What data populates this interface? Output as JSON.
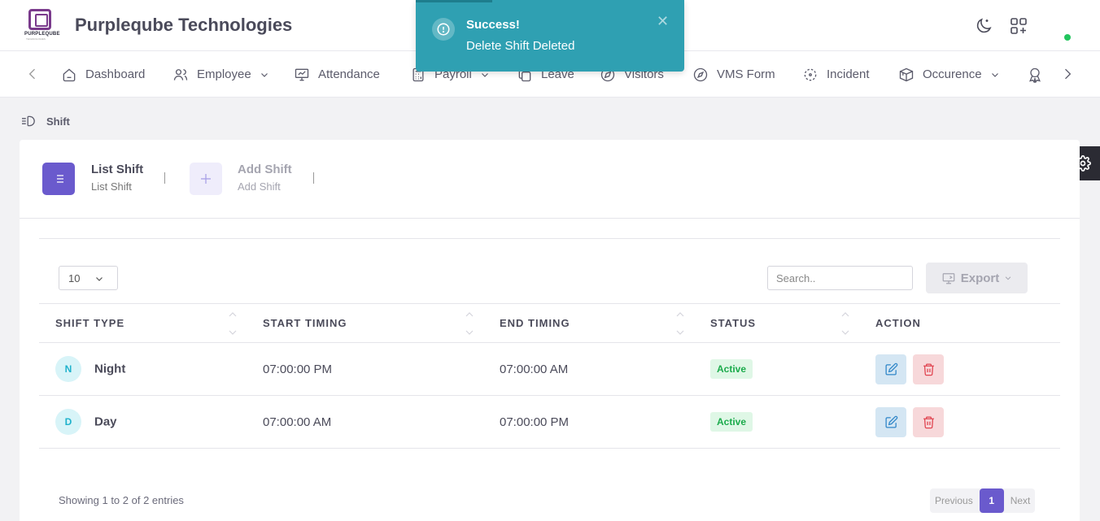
{
  "header": {
    "logo_text": "PURPLEQUBE",
    "logo_sub": "TECHNOLOGIES",
    "company_name": "Purpleqube Technologies"
  },
  "nav": {
    "items": [
      {
        "label": "Dashboard",
        "icon": "home-icon"
      },
      {
        "label": "Employee",
        "icon": "users-icon"
      },
      {
        "label": "Attendance",
        "icon": "presentation-icon"
      },
      {
        "label": "Payroll",
        "icon": "calculator-icon"
      },
      {
        "label": "Leave",
        "icon": "copy-icon"
      },
      {
        "label": "Visitors",
        "icon": "visitor-icon"
      },
      {
        "label": "VMS Form",
        "icon": "compass-icon"
      },
      {
        "label": "Incident",
        "icon": "focus-icon"
      },
      {
        "label": "Occurence",
        "icon": "box-icon"
      }
    ]
  },
  "toast": {
    "title": "Success!",
    "message": "Delete Shift Deleted",
    "color": "#2fa0b2"
  },
  "breadcrumb": {
    "label": "Shift"
  },
  "tabs": [
    {
      "title": "List Shift",
      "subtitle": "List Shift"
    },
    {
      "title": "Add Shift",
      "subtitle": "Add Shift"
    }
  ],
  "table_controls": {
    "page_length": "10",
    "search_placeholder": "Search..",
    "export_label": "Export"
  },
  "table": {
    "columns": [
      "SHIFT TYPE",
      "START TIMING",
      "END TIMING",
      "STATUS",
      "ACTION"
    ],
    "rows": [
      {
        "initial": "N",
        "shift_type": "Night",
        "start": "07:00:00 PM",
        "end": "07:00:00 AM",
        "status": "Active"
      },
      {
        "initial": "D",
        "shift_type": "Day",
        "start": "07:00:00 AM",
        "end": "07:00:00 PM",
        "status": "Active"
      }
    ]
  },
  "footer": {
    "showing": "Showing 1 to 2 of 2 entries",
    "previous": "Previous",
    "page": "1",
    "next": "Next"
  },
  "colors": {
    "accent": "#6a5acd",
    "success": "#1cab4c",
    "danger": "#d9534f"
  }
}
